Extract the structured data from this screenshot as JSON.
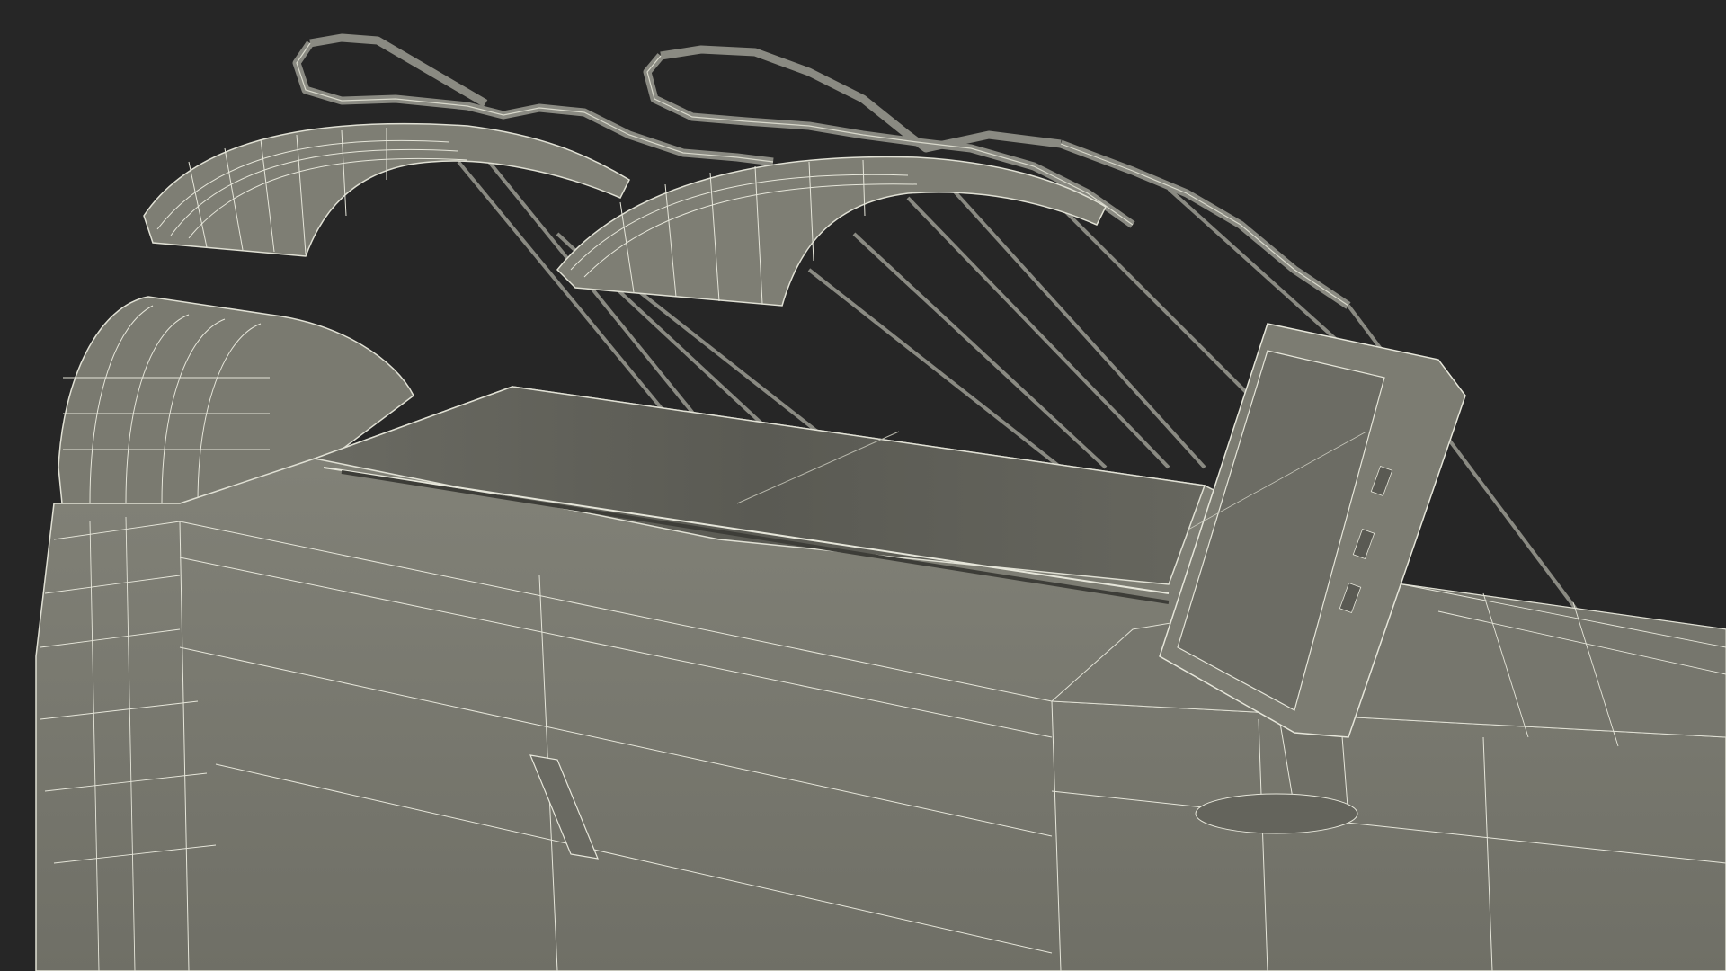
{
  "scene": {
    "subject": "wireframe-3d-render",
    "colors": {
      "background": "#262626",
      "surface": "#7b7b71",
      "surface_dark": "#5f5f57",
      "surface_light": "#8a8a80",
      "wire": "#e8e8dc"
    }
  }
}
